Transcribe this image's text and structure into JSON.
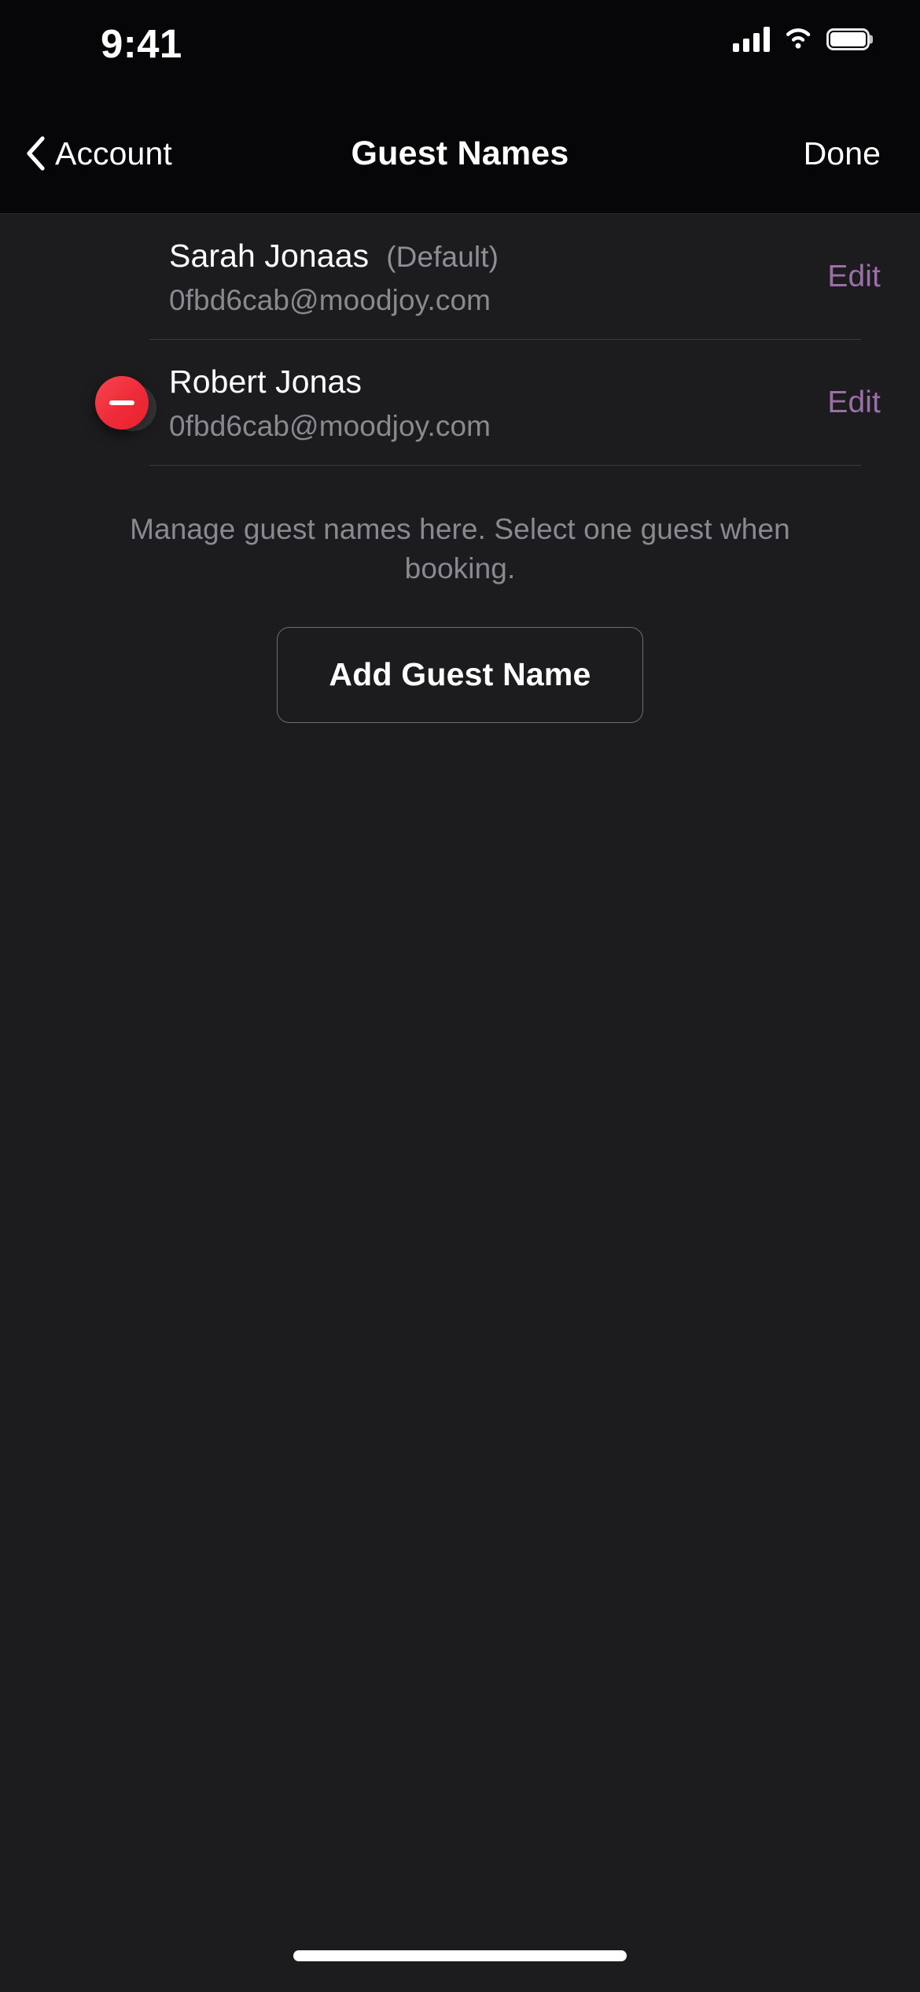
{
  "status_bar": {
    "time": "9:41",
    "cellular_icon": "cellular-signal-icon",
    "wifi_icon": "wifi-icon",
    "battery_icon": "battery-full-icon"
  },
  "nav_bar": {
    "back_icon": "chevron-left-icon",
    "back_label": "Account",
    "title": "Guest Names",
    "done_label": "Done"
  },
  "guests": [
    {
      "name": "Sarah Jonaas",
      "default_tag": "(Default)",
      "email": "0fbd6cab@moodjoy.com",
      "edit_label": "Edit",
      "has_delete": false
    },
    {
      "name": "Robert Jonas",
      "default_tag": "",
      "email": "0fbd6cab@moodjoy.com",
      "edit_label": "Edit",
      "has_delete": true,
      "delete_icon": "minus-circle-icon"
    }
  ],
  "footer": {
    "note": "Manage guest names here. Select one guest when booking.",
    "add_button_label": "Add Guest Name"
  },
  "home_indicator": {
    "label": "home-indicator"
  },
  "colors": {
    "background": "#1C1C1E",
    "nav_background": "#060608",
    "accent_edit": "#9B6FA8",
    "delete_red": "#EE2B38",
    "separator": "#3A3A3C",
    "secondary_text": "#8A8A8E"
  }
}
